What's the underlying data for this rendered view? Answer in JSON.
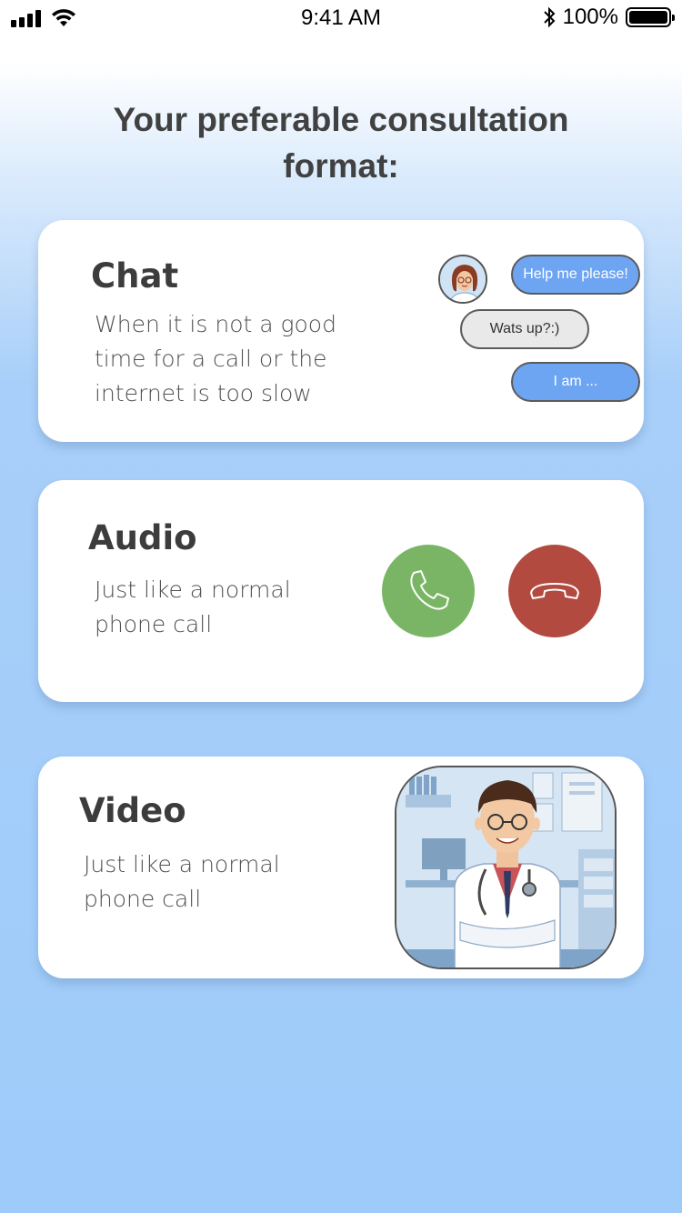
{
  "status_bar": {
    "time": "9:41 AM",
    "battery_percent": "100%",
    "icons": [
      "signal-icon",
      "wifi-icon",
      "bluetooth-icon",
      "battery-icon"
    ]
  },
  "page": {
    "title": "Your preferable consultation format:"
  },
  "options": {
    "chat": {
      "title": "Chat",
      "description": "When it is not a good time for a call or the internet is too slow",
      "bubbles": [
        "Help me please!",
        "Wats up?:)",
        "I am ..."
      ]
    },
    "audio": {
      "title": "Audio",
      "description": "Just like a normal phone call",
      "icons": [
        "phone-accept-icon",
        "phone-decline-icon"
      ]
    },
    "video": {
      "title": "Video",
      "description": "Just like a normal phone call"
    }
  },
  "colors": {
    "background_gradient_end": "#9ecbfa",
    "accept_green": "#7ab565",
    "decline_red": "#b34a40",
    "bubble_blue": "#6ea5f2",
    "bubble_gray": "#e9e9e9"
  }
}
